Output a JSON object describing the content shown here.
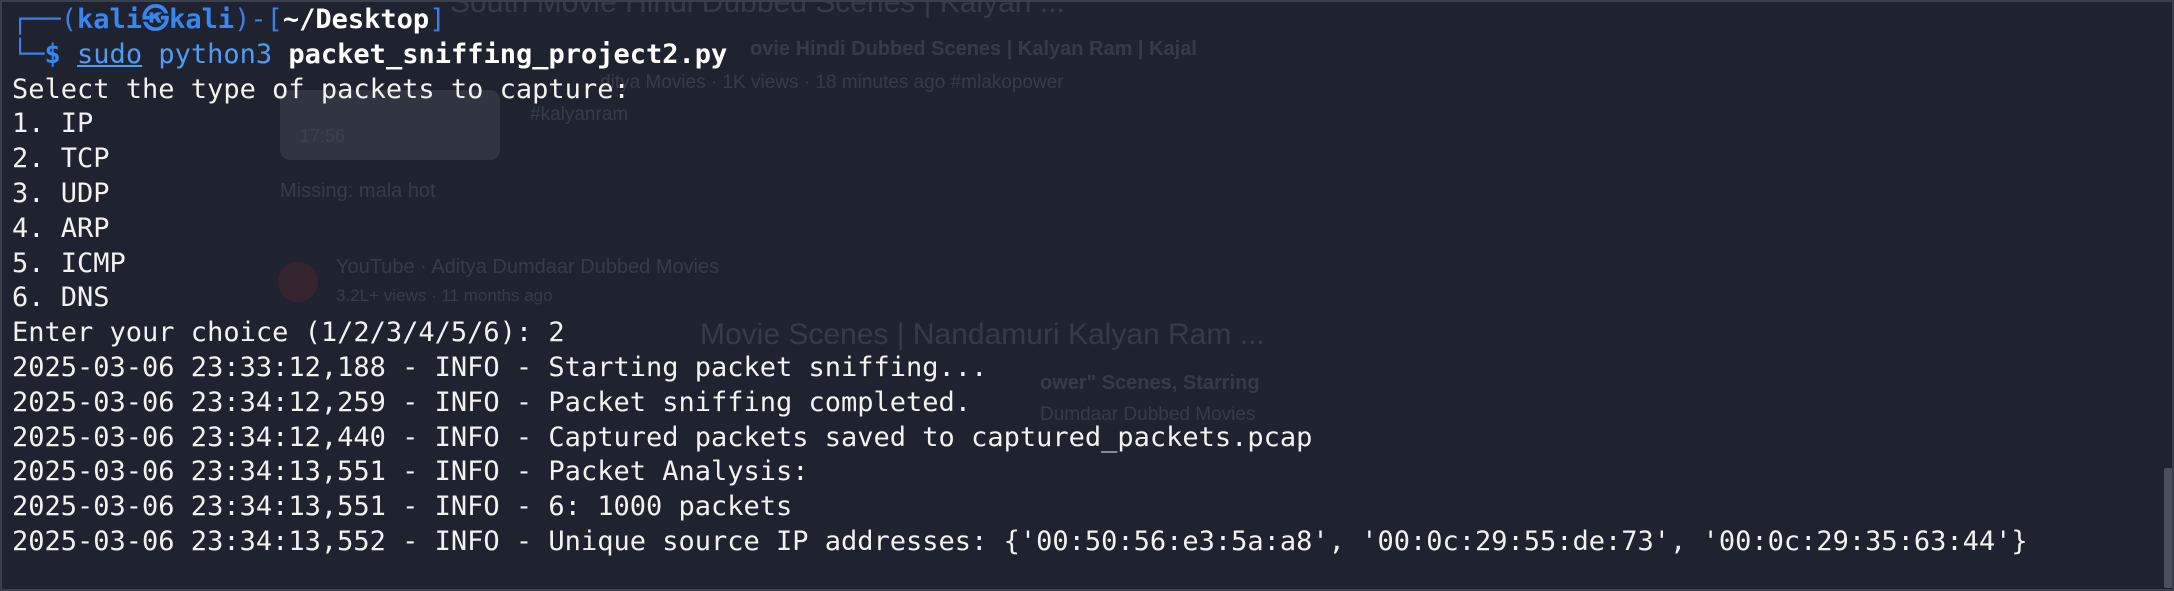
{
  "prompt": {
    "frame_left": "┌──(",
    "user": "kali",
    "at_symbol": "㉿",
    "host": "kali",
    "frame_mid": ")-[",
    "path": "~/Desktop",
    "frame_right": "]",
    "frame_bottom": "└─",
    "dollar": "$",
    "cmd_sudo": "sudo",
    "cmd_python": "python3",
    "cmd_arg": "packet_sniffing_project2.py"
  },
  "output_lines": [
    "Select the type of packets to capture:",
    "1. IP",
    "2. TCP",
    "3. UDP",
    "4. ARP",
    "5. ICMP",
    "6. DNS",
    "Enter your choice (1/2/3/4/5/6): 2",
    "2025-03-06 23:33:12,188 - INFO - Starting packet sniffing...",
    "2025-03-06 23:34:12,259 - INFO - Packet sniffing completed.",
    "2025-03-06 23:34:12,440 - INFO - Captured packets saved to captured_packets.pcap",
    "2025-03-06 23:34:13,551 - INFO - Packet Analysis:",
    "2025-03-06 23:34:13,551 - INFO - 6: 1000 packets",
    "2025-03-06 23:34:13,552 - INFO - Unique source IP addresses: {'00:50:56:e3:5a:a8', '00:0c:29:55:de:73', '00:0c:29:35:63:44'}"
  ],
  "background_ghost": {
    "text1": "South Movie Hindi Dubbed Scenes | Kalyan ...",
    "text2": "ovie Hindi Dubbed Scenes | Kalyan Ram | Kajal",
    "text3": "ditya Movies · 1K views · 18 minutes ago #mlakopower",
    "text4": "#kalyanram",
    "text5": "17:56",
    "text6": "Missing: mala hot",
    "text7": "YouTube · Aditya Dumdaar Dubbed Movies",
    "text8": "3.2L+ views · 11 months ago",
    "text9": "Movie Scenes | Nandamuri Kalyan Ram ...",
    "text10": "ower\" Scenes, Starring",
    "text11": "Dumdaar Dubbed Movies"
  },
  "colors": {
    "background": "#1f2330",
    "prompt_blue": "#3a86f0",
    "text": "#f2f2f2"
  }
}
